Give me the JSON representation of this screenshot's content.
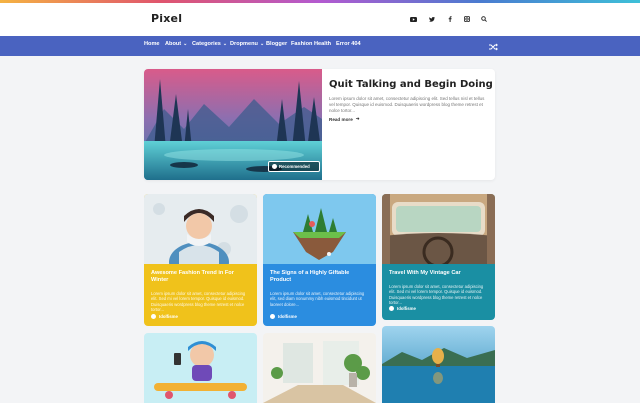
{
  "site": {
    "logo": "Pixel"
  },
  "header": {
    "social_icons": [
      "youtube-icon",
      "twitter-icon",
      "facebook-icon",
      "instagram-icon",
      "search-icon"
    ]
  },
  "nav": {
    "items": [
      {
        "label": "Home",
        "dropdown": false
      },
      {
        "label": "About",
        "dropdown": true
      },
      {
        "label": "Categories",
        "dropdown": true
      },
      {
        "label": "Dropmenu",
        "dropdown": true
      },
      {
        "label": "Blogger",
        "dropdown": false
      },
      {
        "label": "Fashion",
        "dropdown": false
      },
      {
        "label": "Health",
        "dropdown": false
      },
      {
        "label": "Error 404",
        "dropdown": false
      }
    ],
    "shuffle_icon": "shuffle-icon"
  },
  "featured": {
    "title": "Quit Talking and Begin Doing",
    "excerpt": "Lorem ipsum dolor sit amet, consectetur adipiscing elit. Sed tellus nisl et tellus vel tempor. Quisque id euismod. Duisquaeris wordpress blog theme retrest et nolce tortor...",
    "read_more": "Read more",
    "badge": "Recommended"
  },
  "posts": [
    {
      "title": "Awesome Fashion Trend in For Winter",
      "excerpt": "Lorem ipsum dolor sit amet, consectetur adipiscing elit. Sed mi vel lorem tempor. Quisque id euismod. Duisquaeris wordpress blog theme retrest et nolce tortor...",
      "author": "Idolfisme",
      "color": "#f0c21b"
    },
    {
      "title": "The Signs of a Highly Giftable Product",
      "excerpt": "Lorem ipsum dolor sit amet, consectetur adipiscing elit, sed diam nonummy nibh euismod tincidunt ut laoreet dolore...",
      "author": "Idolfisme",
      "color": "#2b8de0"
    },
    {
      "title": "Travel With My Vintage Car",
      "excerpt": "Lorem ipsum dolor sit amet, consectetur adipiscing elit. Sed mi vel lorem tempor. Quisque id euismod. Duisquaeris wordpress blog theme retrest et nolce tortor...",
      "author": "Idolfisme",
      "color": "#1a8fa3"
    }
  ],
  "colors": {
    "nav": "#4a63c0",
    "yellow_card": "#f0c21b",
    "blue_card": "#2b8de0",
    "teal_card": "#1a8fa3"
  }
}
